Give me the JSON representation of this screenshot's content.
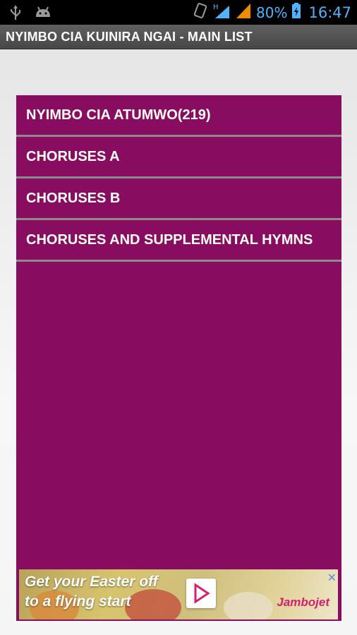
{
  "status_bar": {
    "battery_percent": "80%",
    "time": "16:47",
    "network_label": "H",
    "icons": [
      "usb-icon",
      "android-icon",
      "rotate-icon",
      "network-icon",
      "signal-icon",
      "battery-icon"
    ]
  },
  "app": {
    "title": "NYIMBO CIA KUINIRA NGAI - MAIN LIST"
  },
  "list": {
    "items": [
      {
        "label": "NYIMBO CIA ATUMWO(219)"
      },
      {
        "label": "CHORUSES A"
      },
      {
        "label": "CHORUSES B"
      },
      {
        "label": "CHORUSES AND SUPPLEMENTAL HYMNS"
      }
    ]
  },
  "ad": {
    "line1": "Get your Easter off",
    "line2": "to a flying start",
    "brand": "Jambojet",
    "close_glyph": "✕"
  },
  "colors": {
    "panel": "#880c5f",
    "divider": "#8a8a8a",
    "title_bar": "#4f4f4f",
    "status_text": "#4fb3ff"
  }
}
